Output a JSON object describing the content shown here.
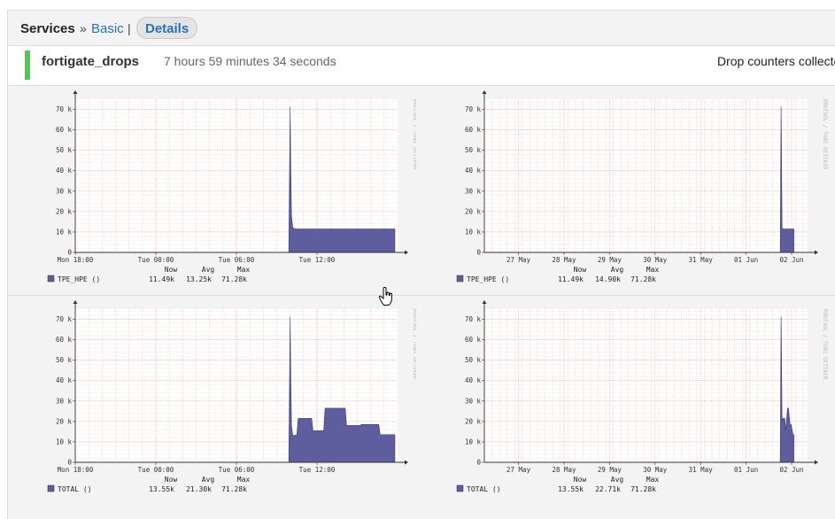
{
  "breadcrumb": {
    "services": "Services",
    "sep1": "»",
    "basic": "Basic",
    "sep2": "|",
    "details": "Details"
  },
  "service": {
    "name": "fortigate_drops",
    "duration": "7 hours 59 minutes 34 seconds",
    "output": "Drop counters collected"
  },
  "colors": {
    "fill": "#5e5e9e",
    "status_ok": "#5bc25b",
    "link": "#2b70b8"
  },
  "watermark": "RRDTOOL / TOBI OETIKER",
  "graphs": [
    {
      "id": "tpe-day",
      "legend_label": "TPE_HPE ()",
      "stats_header": {
        "now": "Now",
        "avg": "Avg",
        "max": "Max"
      },
      "now": "11.49k",
      "avg": "13.25k",
      "max": "71.28k",
      "chart_data": {
        "type": "area",
        "ylim": [
          0,
          75000
        ],
        "yticks": [
          "0",
          "10 k",
          "20 k",
          "30 k",
          "40 k",
          "50 k",
          "60 k",
          "70 k"
        ],
        "xticks": [
          "Mon 18:00",
          "Tue 00:00",
          "Tue 06:00",
          "Tue 12:00"
        ],
        "x_range_hours": [
          0,
          24
        ],
        "xtick_hours": [
          0,
          6,
          12,
          18
        ],
        "series": [
          {
            "name": "TPE_HPE",
            "x": [
              15.9,
              16.0,
              16.05,
              16.1,
              16.2,
              16.4,
              23.8
            ],
            "values": [
              0,
              71280,
              40000,
              18000,
              12000,
              11490,
              11490
            ]
          }
        ]
      }
    },
    {
      "id": "tpe-week",
      "legend_label": "TPE_HPE ()",
      "stats_header": {
        "now": "Now",
        "avg": "Avg",
        "max": "Max"
      },
      "now": "11.49k",
      "avg": "14.90k",
      "max": "71.28k",
      "chart_data": {
        "type": "area",
        "ylim": [
          0,
          75000
        ],
        "yticks": [
          "0",
          "10 k",
          "20 k",
          "30 k",
          "40 k",
          "50 k",
          "60 k",
          "70 k"
        ],
        "xticks": [
          "27 May",
          "28 May",
          "29 May",
          "30 May",
          "31 May",
          "01 Jun",
          "02 Jun"
        ],
        "x_range_days": [
          0,
          7.1
        ],
        "xtick_days": [
          0.75,
          1.75,
          2.75,
          3.75,
          4.75,
          5.75,
          6.75
        ],
        "series": [
          {
            "name": "TPE_HPE",
            "x": [
              6.5,
              6.52,
              6.54,
              6.56,
              6.8
            ],
            "values": [
              0,
              71280,
              12000,
              11490,
              11490
            ]
          }
        ]
      }
    },
    {
      "id": "total-day",
      "legend_label": "TOTAL ()",
      "stats_header": {
        "now": "Now",
        "avg": "Avg",
        "max": "Max"
      },
      "now": "13.55k",
      "avg": "21.30k",
      "max": "71.28k",
      "chart_data": {
        "type": "area",
        "ylim": [
          0,
          75000
        ],
        "yticks": [
          "0",
          "10 k",
          "20 k",
          "30 k",
          "40 k",
          "50 k",
          "60 k",
          "70 k"
        ],
        "xticks": [
          "Mon 18:00",
          "Tue 00:00",
          "Tue 06:00",
          "Tue 12:00"
        ],
        "x_range_hours": [
          0,
          24
        ],
        "xtick_hours": [
          0,
          6,
          12,
          18
        ],
        "series": [
          {
            "name": "TOTAL",
            "x": [
              15.9,
              16.0,
              16.05,
              16.1,
              16.2,
              16.5,
              16.6,
              17.6,
              17.7,
              18.5,
              18.6,
              20.1,
              20.2,
              21.2,
              21.3,
              22.6,
              22.7,
              23.8
            ],
            "values": [
              0,
              71280,
              40000,
              18000,
              13000,
              13500,
              21500,
              21500,
              15500,
              15500,
              26500,
              26500,
              18000,
              18000,
              18500,
              18500,
              13550,
              13550
            ]
          }
        ]
      }
    },
    {
      "id": "total-week",
      "legend_label": "TOTAL ()",
      "stats_header": {
        "now": "Now",
        "avg": "Avg",
        "max": "Max"
      },
      "now": "13.55k",
      "avg": "22.71k",
      "max": "71.28k",
      "chart_data": {
        "type": "area",
        "ylim": [
          0,
          75000
        ],
        "yticks": [
          "0",
          "10 k",
          "20 k",
          "30 k",
          "40 k",
          "50 k",
          "60 k",
          "70 k"
        ],
        "xticks": [
          "27 May",
          "28 May",
          "29 May",
          "30 May",
          "31 May",
          "01 Jun",
          "02 Jun"
        ],
        "x_range_days": [
          0,
          7.1
        ],
        "xtick_days": [
          0.75,
          1.75,
          2.75,
          3.75,
          4.75,
          5.75,
          6.75
        ],
        "series": [
          {
            "name": "TOTAL",
            "x": [
              6.5,
              6.52,
              6.54,
              6.56,
              6.6,
              6.62,
              6.66,
              6.68,
              6.72,
              6.74,
              6.78,
              6.8
            ],
            "values": [
              0,
              71280,
              20000,
              21500,
              21500,
              15500,
              26500,
              26500,
              18000,
              18500,
              13550,
              13550
            ]
          }
        ]
      }
    }
  ]
}
